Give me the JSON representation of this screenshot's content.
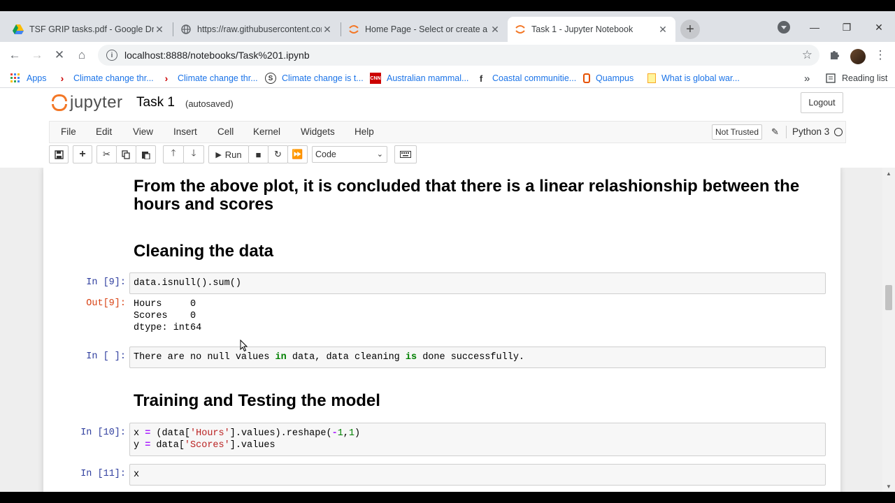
{
  "browser": {
    "tabs": [
      {
        "title": "TSF GRIP tasks.pdf - Google Drive",
        "favicon": "google-drive-icon"
      },
      {
        "title": "https://raw.githubusercontent.com",
        "favicon": "globe-icon"
      },
      {
        "title": "Home Page - Select or create a notebook",
        "favicon": "jupyter-icon"
      },
      {
        "title": "Task 1 - Jupyter Notebook",
        "favicon": "jupyter-icon"
      }
    ],
    "active_tab_index": 3,
    "url": "localhost:8888/notebooks/Task%201.ipynb",
    "bookmarks": [
      {
        "label": "Apps",
        "icon": "apps-grid-icon"
      },
      {
        "label": "Climate change thr...",
        "icon": "bookmark-chevron-icon"
      },
      {
        "label": "Climate change thr...",
        "icon": "bookmark-chevron-icon"
      },
      {
        "label": "Climate change is t...",
        "icon": "s-logo-icon"
      },
      {
        "label": "Australian mammal...",
        "icon": "cnn-icon"
      },
      {
        "label": "Coastal communitie...",
        "icon": "facebook-icon"
      },
      {
        "label": "Quampus",
        "icon": "quampus-icon"
      },
      {
        "label": "What is global war...",
        "icon": "folder-icon"
      }
    ],
    "overflow_label": "»",
    "reading_list_label": "Reading list"
  },
  "jupyter": {
    "logo_text": "jupyter",
    "notebook_name": "Task 1",
    "autosave_status": "(autosaved)",
    "logout_label": "Logout",
    "menus": [
      "File",
      "Edit",
      "View",
      "Insert",
      "Cell",
      "Kernel",
      "Widgets",
      "Help"
    ],
    "trust_status": "Not Trusted",
    "kernel_name": "Python 3",
    "run_label": "Run",
    "cell_type": "Code"
  },
  "cells": {
    "md_conclusion": "From the above plot, it is concluded that there is a linear relashionship between the hours and scores",
    "md_cleaning": "Cleaning the data",
    "in9_prompt": "In [9]:",
    "in9_code": "data.isnull().sum()",
    "out9_prompt": "Out[9]:",
    "out9_text": "Hours     0\nScores    0\ndtype: int64",
    "in_blank_prompt": "In [ ]:",
    "in_blank_parts": [
      "There are no null values ",
      "in",
      " data, data cleaning ",
      "is",
      " done successfully."
    ],
    "md_training": "Training and Testing the model",
    "in10_prompt": "In [10]:",
    "in10_line1_parts": [
      "x ",
      "=",
      " (data[",
      "'Hours'",
      "].values).reshape(",
      "-",
      "1",
      ",",
      "1",
      ")"
    ],
    "in10_line2_parts": [
      "y ",
      "=",
      " data[",
      "'Scores'",
      "].values"
    ],
    "in11_prompt": "In [11]:",
    "in11_code": "x"
  }
}
